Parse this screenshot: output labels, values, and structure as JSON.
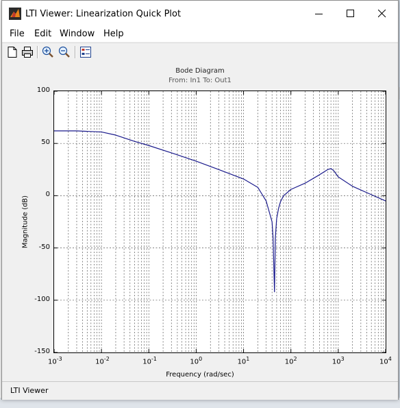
{
  "window": {
    "title": "LTI Viewer: Linearization Quick Plot",
    "controls": {
      "minimize": "minimize",
      "maximize": "maximize",
      "close": "close"
    }
  },
  "menu": {
    "items": [
      "File",
      "Edit",
      "Window",
      "Help"
    ]
  },
  "toolbar": {
    "buttons": [
      "new-file-icon",
      "print-icon",
      "zoom-in-icon",
      "zoom-out-icon",
      "plot-configuration-icon"
    ]
  },
  "plot": {
    "title": "Bode Diagram",
    "subtitle": "From: In1  To: Out1",
    "ylabel": "Magnitude (dB)",
    "xlabel": "Frequency  (rad/sec)"
  },
  "statusbar": {
    "text": "LTI Viewer"
  },
  "chart_data": {
    "type": "line",
    "title": "Bode Diagram",
    "subtitle": "From: In1  To: Out1",
    "xlabel": "Frequency  (rad/sec)",
    "ylabel": "Magnitude (dB)",
    "xscale": "log",
    "xlim": [
      0.001,
      10000
    ],
    "ylim": [
      -150,
      100
    ],
    "xticks": [
      0.001,
      0.01,
      0.1,
      1,
      10,
      100,
      1000,
      10000
    ],
    "xtick_labels": [
      [
        "10",
        "-3"
      ],
      [
        "10",
        "-2"
      ],
      [
        "10",
        "-1"
      ],
      [
        "10",
        "0"
      ],
      [
        "10",
        "1"
      ],
      [
        "10",
        "2"
      ],
      [
        "10",
        "3"
      ],
      [
        "10",
        "4"
      ]
    ],
    "yticks": [
      100,
      50,
      0,
      -50,
      -100,
      -150
    ],
    "ytick_labels": [
      "100",
      "50",
      "0",
      "-50",
      "-100",
      "-150"
    ],
    "grid": true,
    "series": [
      {
        "color": "#1a1a8c",
        "x": [
          0.001,
          0.003,
          0.01,
          0.02,
          0.05,
          0.1,
          0.3,
          1,
          3,
          10,
          20,
          30,
          40,
          42,
          45,
          47,
          50,
          55,
          60,
          70,
          100,
          200,
          400,
          600,
          700,
          800,
          1000,
          2000,
          5000,
          10000
        ],
        "y": [
          62,
          62,
          61,
          58,
          52,
          48,
          41,
          33,
          25,
          16,
          8,
          -5,
          -25,
          -40,
          -92,
          -40,
          -22,
          -12,
          -6,
          0,
          6,
          12,
          20,
          25,
          26,
          24,
          18,
          9,
          1,
          -5
        ]
      }
    ]
  }
}
